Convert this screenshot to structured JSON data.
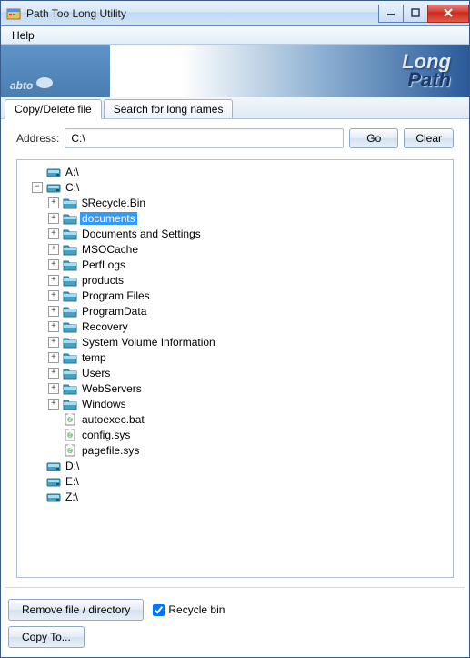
{
  "window": {
    "title": "Path Too Long Utility"
  },
  "menu": {
    "help": "Help"
  },
  "banner": {
    "brand": "abto",
    "logo_long": "Long",
    "logo_path": "Path"
  },
  "tabs": {
    "copy_delete": "Copy/Delete file",
    "search_long": "Search for long names"
  },
  "address": {
    "label": "Address:",
    "value": "C:\\",
    "go": "Go",
    "clear": "Clear"
  },
  "tree": {
    "drives": [
      {
        "label": "A:\\",
        "expandable": false
      },
      {
        "label": "C:\\",
        "expandable": true,
        "expanded": true,
        "children": [
          {
            "label": "$Recycle.Bin",
            "type": "folder",
            "expandable": true
          },
          {
            "label": "documents",
            "type": "folder",
            "expandable": true,
            "selected": true
          },
          {
            "label": "Documents and Settings",
            "type": "folder",
            "expandable": true
          },
          {
            "label": "MSOCache",
            "type": "folder",
            "expandable": true
          },
          {
            "label": "PerfLogs",
            "type": "folder",
            "expandable": true
          },
          {
            "label": "products",
            "type": "folder",
            "expandable": true
          },
          {
            "label": "Program Files",
            "type": "folder",
            "expandable": true
          },
          {
            "label": "ProgramData",
            "type": "folder",
            "expandable": true
          },
          {
            "label": "Recovery",
            "type": "folder",
            "expandable": true
          },
          {
            "label": "System Volume Information",
            "type": "folder",
            "expandable": true
          },
          {
            "label": "temp",
            "type": "folder",
            "expandable": true
          },
          {
            "label": "Users",
            "type": "folder",
            "expandable": true
          },
          {
            "label": "WebServers",
            "type": "folder",
            "expandable": true
          },
          {
            "label": "Windows",
            "type": "folder",
            "expandable": true
          },
          {
            "label": "autoexec.bat",
            "type": "file",
            "expandable": false
          },
          {
            "label": "config.sys",
            "type": "file",
            "expandable": false
          },
          {
            "label": "pagefile.sys",
            "type": "file",
            "expandable": false
          }
        ]
      },
      {
        "label": "D:\\",
        "expandable": false
      },
      {
        "label": "E:\\",
        "expandable": false
      },
      {
        "label": "Z:\\",
        "expandable": false
      }
    ]
  },
  "bottom": {
    "remove": "Remove file / directory",
    "recycle": "Recycle bin",
    "recycle_checked": true,
    "copy_to": "Copy To..."
  }
}
